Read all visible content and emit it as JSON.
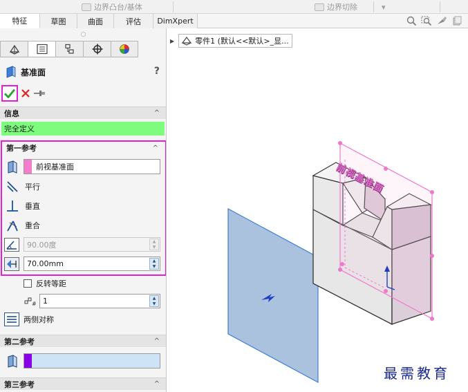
{
  "ribbon": {
    "boss_loft": "边界凸台/基体",
    "cut_loft": "边界切除",
    "dropdown": "▾"
  },
  "tabs": [
    {
      "label": "特征",
      "active": true
    },
    {
      "label": "草图",
      "active": false
    },
    {
      "label": "曲面",
      "active": false
    },
    {
      "label": "评估",
      "active": false
    },
    {
      "label": "DimXpert",
      "active": false
    }
  ],
  "panel": {
    "grip": "○",
    "title": "基准面",
    "help": "?",
    "info_section": "信息",
    "status_text": "完全定义",
    "collapse_caret": "^",
    "first_ref": {
      "header": "第一参考",
      "selection": "前视基准面",
      "parallel": "平行",
      "perpendicular": "垂直",
      "coincident": "重合",
      "angle_value": "90.00度",
      "offset_value": "70.00mm",
      "flip_offset": "反转等距",
      "plane_count": "1",
      "mid_plane": "两侧对称"
    },
    "second_ref": {
      "header": "第二参考"
    },
    "third_ref": {
      "header": "第三参考"
    }
  },
  "viewport": {
    "breadcrumb": "零件1 (默认<<默认>_显...",
    "plane_label": "前视基准面",
    "watermark": "最需教育"
  },
  "colors": {
    "highlight": "#e11fd6",
    "status_green": "#7dfc7d",
    "ref1_swatch": "#f37ccd",
    "ref2_swatch": "#8a00e6",
    "ref2_field": "#cfe3f7",
    "plane_fill": "#8fadd3"
  }
}
